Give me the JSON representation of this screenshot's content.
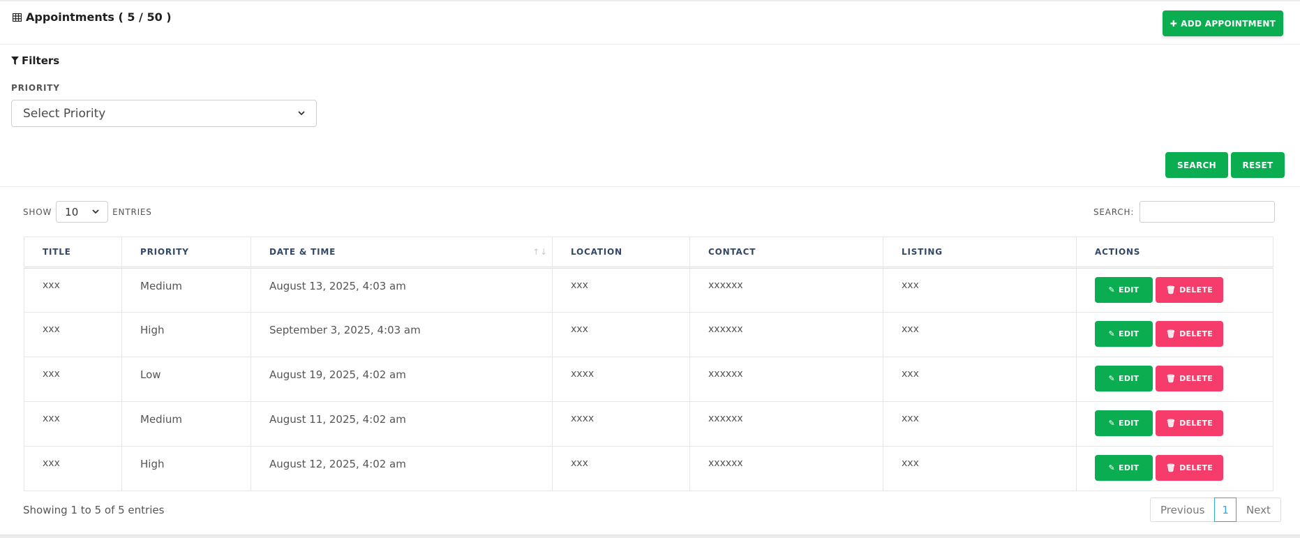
{
  "header": {
    "title": "Appointments ( 5 / 50 )",
    "add_label": "ADD APPOINTMENT"
  },
  "filters": {
    "title": "Filters",
    "priority_label": "PRIORITY",
    "priority_placeholder": "Select Priority",
    "search_label": "SEARCH",
    "reset_label": "RESET"
  },
  "table_controls": {
    "show_label": "SHOW",
    "entries_value": "10",
    "entries_label": "ENTRIES",
    "search_label": "SEARCH:"
  },
  "columns": [
    "TITLE",
    "PRIORITY",
    "DATE & TIME",
    "LOCATION",
    "CONTACT",
    "LISTING",
    "ACTIONS"
  ],
  "rows": [
    {
      "title": "xxx",
      "priority": "Medium",
      "datetime": "August 13, 2025, 4:03 am",
      "location": "xxx",
      "contact": "xxxxxx",
      "listing": "xxx"
    },
    {
      "title": "xxx",
      "priority": "High",
      "datetime": "September 3, 2025, 4:03 am",
      "location": "xxx",
      "contact": "xxxxxx",
      "listing": "xxx"
    },
    {
      "title": "xxx",
      "priority": "Low",
      "datetime": "August 19, 2025, 4:02 am",
      "location": "xxxx",
      "contact": "xxxxxx",
      "listing": "xxx"
    },
    {
      "title": "xxx",
      "priority": "Medium",
      "datetime": "August 11, 2025, 4:02 am",
      "location": "xxxx",
      "contact": "xxxxxx",
      "listing": "xxx"
    },
    {
      "title": "xxx",
      "priority": "High",
      "datetime": "August 12, 2025, 4:02 am",
      "location": "xxx",
      "contact": "xxxxxx",
      "listing": "xxx"
    }
  ],
  "row_actions": {
    "edit_label": "EDIT",
    "delete_label": "DELETE"
  },
  "footer": {
    "info": "Showing 1 to 5 of 5 entries",
    "previous_label": "Previous",
    "page": "1",
    "next_label": "Next"
  },
  "colors": {
    "accent_green": "#0aad4f",
    "danger_red": "#f53c6a",
    "page_link_blue": "#2ea7e0"
  },
  "icons": {
    "title": "table-icon",
    "add": "plus-icon",
    "filters": "filter-icon",
    "edit": "edit-icon",
    "delete": "trash-icon",
    "sort": "sort-icon"
  }
}
